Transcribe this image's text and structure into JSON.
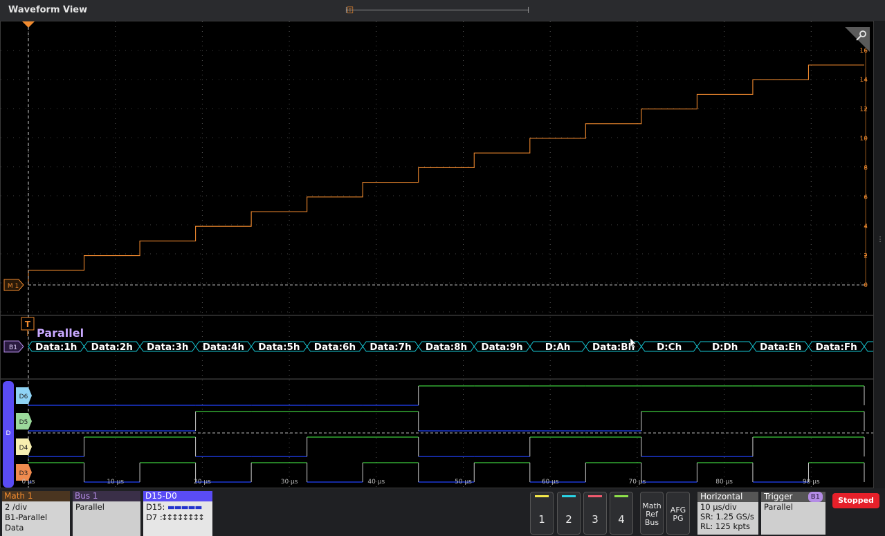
{
  "window": {
    "title": "Waveform View"
  },
  "overview": {
    "trigger_marker": "T"
  },
  "math_waveform": {
    "label": "M 1",
    "color": "#f0892e",
    "right_scale": [
      "16",
      "14",
      "12",
      "10",
      "8",
      "6",
      "4",
      "2",
      "0"
    ],
    "steps": [
      1,
      2,
      3,
      4,
      5,
      6,
      7,
      8,
      9,
      10,
      11,
      12,
      13,
      14,
      15
    ]
  },
  "bus": {
    "trigger_marker": "T",
    "name": "Parallel",
    "label": "B1",
    "label_color": "#c9a9ff",
    "packets": [
      "Data:1h",
      "Data:2h",
      "Data:3h",
      "Data:4h",
      "Data:5h",
      "Data:6h",
      "Data:7h",
      "Data:8h",
      "Data:9h",
      "D:Ah",
      "Data:Bh",
      "D:Ch",
      "D:Dh",
      "Data:Eh",
      "Data:Fh"
    ],
    "packet_color": "#16c7d4"
  },
  "digital": {
    "group_label": "D",
    "channels": [
      {
        "name": "D6",
        "color": "#8fd3f5",
        "pattern": [
          0,
          0,
          0,
          0,
          0,
          0,
          0,
          1,
          1,
          1,
          1,
          1,
          1,
          1,
          1
        ]
      },
      {
        "name": "D5",
        "color": "#9bd99b",
        "pattern": [
          0,
          0,
          0,
          1,
          1,
          1,
          1,
          0,
          0,
          0,
          0,
          1,
          1,
          1,
          1
        ]
      },
      {
        "name": "D4",
        "color": "#f7efb0",
        "pattern": [
          0,
          1,
          1,
          0,
          0,
          1,
          1,
          0,
          0,
          1,
          1,
          0,
          0,
          1,
          1
        ]
      },
      {
        "name": "D3",
        "color": "#f08a4e",
        "pattern": [
          1,
          0,
          1,
          0,
          1,
          0,
          1,
          0,
          1,
          0,
          1,
          0,
          1,
          0,
          1
        ]
      }
    ],
    "high_color": "#3ccc3c",
    "low_color": "#2244ff"
  },
  "time_axis": {
    "labels": [
      "0 µs",
      "10 µs",
      "20 µs",
      "30 µs",
      "40 µs",
      "50 µs",
      "60 µs",
      "70 µs",
      "80 µs",
      "90 µs"
    ]
  },
  "badges": {
    "math": {
      "title": "Math 1",
      "lines": [
        "2 /div",
        "B1-Parallel",
        "Data"
      ],
      "color": "#f08a2e"
    },
    "bus": {
      "title": "Bus 1",
      "lines": [
        "Parallel"
      ],
      "color": "#b48ce6"
    },
    "digital": {
      "title": "D15-D0",
      "lines": [
        "D15:",
        "D7"
      ]
    }
  },
  "channel_buttons": [
    {
      "label": "1",
      "color": "#f5e94a"
    },
    {
      "label": "2",
      "color": "#2ad4e6"
    },
    {
      "label": "3",
      "color": "#f05a6e"
    },
    {
      "label": "4",
      "color": "#8fe04a"
    }
  ],
  "add_buttons": {
    "math_ref_bus": [
      "Math",
      "Ref",
      "Bus"
    ],
    "afg_pg": [
      "AFG",
      "PG"
    ]
  },
  "horizontal": {
    "title": "Horizontal",
    "lines": [
      "10 µs/div",
      "SR: 1.25 GS/s",
      "RL: 125 kpts"
    ]
  },
  "trigger": {
    "title": "Trigger",
    "source": "B1",
    "lines": [
      "Parallel"
    ]
  },
  "acq_status": "Stopped"
}
